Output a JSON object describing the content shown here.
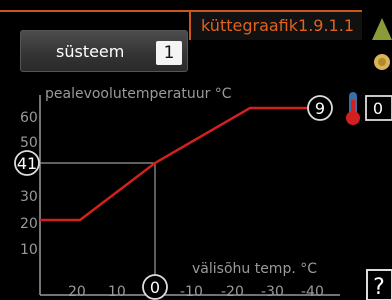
{
  "header": {
    "title": "küttegraafik1.9.1.1"
  },
  "system": {
    "label": "süsteem",
    "value": "1"
  },
  "chart": {
    "ylabel": "pealevoolutemperatuur °C",
    "xlabel": "välisõhu temp. °C",
    "y_ticks": [
      "60",
      "50",
      "40",
      "30",
      "20",
      "10"
    ],
    "x_ticks": [
      "20",
      "10",
      "0",
      "-10",
      "-20",
      "-30",
      "-40"
    ],
    "y_marker": "41",
    "x_marker": "0",
    "curve_number": "9",
    "offset_value": "0",
    "colors": {
      "curve": "#d22020",
      "accent": "#e0621f",
      "grid": "#9a9a9a"
    }
  },
  "chart_data": {
    "type": "line",
    "x": [
      20,
      15,
      -10,
      -25,
      -40
    ],
    "y": [
      20,
      20,
      40,
      60,
      60
    ],
    "xlabel": "välisõhu temp. °C",
    "ylabel": "pealevoolutemperatuur °C",
    "xlim": [
      25,
      -45
    ],
    "ylim": [
      5,
      65
    ],
    "grid": false
  },
  "icons": {
    "help": "?"
  }
}
